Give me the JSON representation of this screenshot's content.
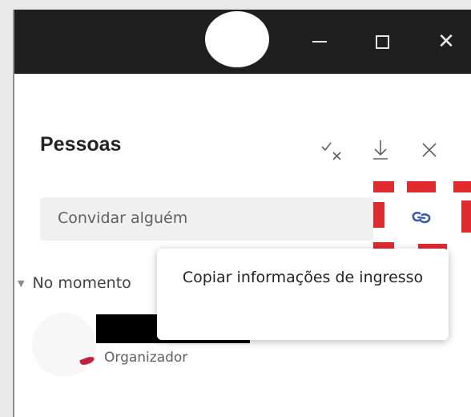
{
  "window": {
    "controls": {
      "minimize": "minimize-icon",
      "maximize": "maximize-icon",
      "close": "close-icon"
    }
  },
  "panel": {
    "title": "Pessoas",
    "header_icons": [
      "mute-all-icon",
      "download-icon",
      "close-icon"
    ],
    "invite": {
      "placeholder": "Convidar alguém",
      "link_icon": "link-icon"
    },
    "section_label": "No momento",
    "participant": {
      "role": "Organizador"
    },
    "tooltip": {
      "text": "Copiar informações de ingresso"
    }
  },
  "colors": {
    "titlebar": "#1f1f1f",
    "highlight_dash": "#e02a2e",
    "link_icon": "#3d5ba9"
  }
}
